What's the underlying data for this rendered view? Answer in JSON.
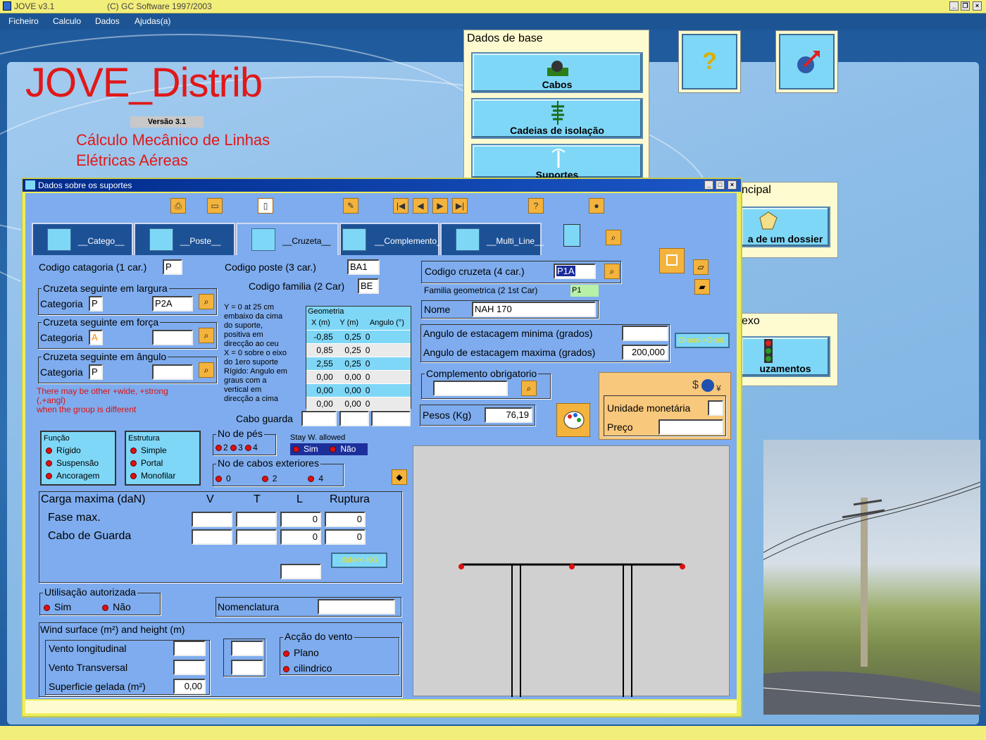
{
  "app": {
    "title": "JOVE v3.1",
    "copyright": "(C) GC Software 1997/2003"
  },
  "menu": [
    "Ficheiro",
    "Calculo",
    "Dados",
    "Ajudas(a)"
  ],
  "splash": {
    "title": "JOVE_Distrib",
    "version": "Versão 3.1",
    "subtitle1": "Cálculo Mecânico de Linhas",
    "subtitle2": "Elétricas Aéreas"
  },
  "base_panel": {
    "heading": "Dados de base",
    "buttons": [
      "Cabos",
      "Cadeias de isolação",
      "Suportes"
    ]
  },
  "side_panels": {
    "principal_heading": "ncipal",
    "principal_button": "a de um dossier",
    "anexo_heading": "exo",
    "anexo_button": "uzamentos"
  },
  "dialog": {
    "title": "Dados sobre os suportes",
    "tabs": [
      "__Catego__",
      "__Poste__",
      "__Cruzeta__",
      "__Complemento__",
      "__Multi_Line__"
    ],
    "codigo_categoria_label": "Codigo catagoria (1 car.)",
    "codigo_categoria_value": "P",
    "codigo_poste_label": "Codigo poste (3 car.)",
    "codigo_poste_value": "BA1",
    "codigo_familia_label": "Codigo familia (2 Car)",
    "codigo_familia_value": "BE",
    "codigo_cruzeta_label": "Codigo cruzeta (4 car.)",
    "codigo_cruzeta_value": "P1A",
    "familia_geometrica_label": "Familia geometrica (2 1st Car)",
    "familia_geometrica_value": "P1",
    "nome_label": "Nome",
    "nome_value": "NAH 170",
    "seguinte_largura": {
      "title": "Cruzeta seguinte em largura",
      "categoria_label": "Categoria",
      "categoria": "P",
      "value": "P2A"
    },
    "seguinte_forca": {
      "title": "Cruzeta seguinte em força",
      "categoria_label": "Categoria",
      "categoria": "A",
      "value": ""
    },
    "seguinte_angulo": {
      "title": "Cruzeta seguinte em ângulo",
      "categoria_label": "Categoria",
      "categoria": "P",
      "value": ""
    },
    "warning": [
      "There may be other +wide, +strong",
      "(,+angl)",
      "when the group is different"
    ],
    "note": [
      "Y = 0 at 25 cm",
      "embaixo da cima",
      "do suporte,",
      "positiva em",
      "direcção ao ceu",
      "X = 0 sobre o eixo",
      "do 1ero suporte",
      "Rígido: Angulo em",
      "graus com a",
      "vertical em",
      "direcção a cima"
    ],
    "geometria": {
      "title": "Geometria",
      "headers": [
        "X (m)",
        "Y (m)",
        "Angulo (°)"
      ],
      "rows": [
        [
          "-0,85",
          "0,25",
          "0"
        ],
        [
          "0,85",
          "0,25",
          "0"
        ],
        [
          "2,55",
          "0,25",
          "0"
        ],
        [
          "0,00",
          "0,00",
          "0"
        ],
        [
          "0,00",
          "0,00",
          "0"
        ],
        [
          "0,00",
          "0,00",
          "0"
        ]
      ]
    },
    "angulo_min_label": "Angulo de estacagem minima (grados)",
    "angulo_min_value": "",
    "angulo_max_label": "Angulo de estacagem maxima (grados)",
    "angulo_max_value": "200,000",
    "graus_button": "Graus->Grad.",
    "complemento_label": "Complemento obrigatorio",
    "pesos_label": "Pesos (Kg)",
    "pesos_value": "76,19",
    "unidade_label": "Unidade monetária",
    "preco_label": "Preço",
    "cabo_guarda_label": "Cabo guarda",
    "funcao": {
      "title": "Função",
      "items": [
        "Rígido",
        "Suspensão",
        "Ancoragem"
      ]
    },
    "estrutura": {
      "title": "Estrutura",
      "items": [
        "Simple",
        "Portal",
        "Monofilar"
      ]
    },
    "no_pes": {
      "title": "No de pés",
      "options": [
        "2",
        "3",
        "4"
      ]
    },
    "stay": {
      "title": "Stay W. allowed",
      "options": [
        "Sim",
        "Não"
      ]
    },
    "no_cabos": {
      "title": "No de cabos exteriores",
      "options": [
        "0",
        "2",
        "4"
      ]
    },
    "carga": {
      "title": "Carga maxima (daN)",
      "cols": [
        "V",
        "T",
        "L",
        "Ruptura"
      ],
      "fase_label": "Fase max.",
      "fase": [
        "",
        "",
        "0",
        "0"
      ],
      "cabo_label": "Cabo de Guarda",
      "cabo": [
        "",
        "",
        "0",
        "0"
      ],
      "convert_button": "daN<<-KG"
    },
    "utilisacao": {
      "title": "Utilisação autorizada",
      "options": [
        "Sim",
        "Não"
      ]
    },
    "nomenclatura_label": "Nomenclatura",
    "wind": {
      "title": "Wind surface (m²) and height (m)",
      "longitudinal": "Vento longitudinal",
      "transversal": "Vento Transversal",
      "gelada": "Superficie gelada (m²)",
      "gelada_value": "0,00"
    },
    "accao": {
      "title": "Acção do vento",
      "options": [
        "Plano",
        "cilindrico"
      ]
    }
  },
  "colors": {
    "accent_red": "#e01818",
    "dialog_bg": "#7eacee",
    "button_cyan": "#7fd7f7",
    "toolbar_orange": "#f4b33c"
  }
}
